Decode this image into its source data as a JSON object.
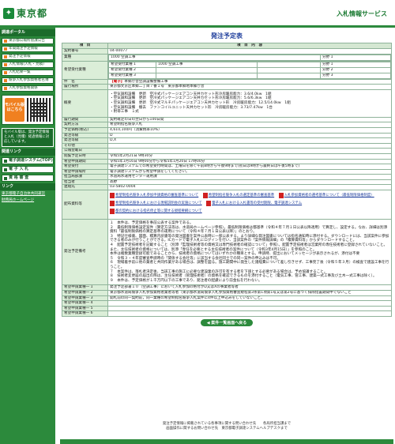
{
  "header": {
    "logo_text": "東京都",
    "service_title": "入札情報サービス"
  },
  "sidebar": {
    "menu_head": "調達ポータル",
    "items": [
      "東京都公報所管課公告",
      "年間発注予定情報",
      "発注予定情報",
      "入札情報(入札・見積)",
      "入札結果一覧",
      "競争入札参加資格者名簿",
      "入札参加資格関係"
    ],
    "mobile_button": "モバイル版はこちら",
    "mobile_note": "モバイル版は、発注予定情報と入札（見積）経過情報に対応しています。",
    "links_head": "関連リンク",
    "big_items": [
      "電子調達システム(TOP)",
      "電 子 入 札",
      "資 格 審 査"
    ],
    "links_head2": "リンク",
    "links": [
      "東京都電子自治体共同運営",
      "財務局ホームページ"
    ]
  },
  "main": {
    "page_title": "発注予定表",
    "col_item": "項　目",
    "col_content": "項　目　内　容",
    "rows": {
      "contract_no_label": "契約番号",
      "contract_no": "04-00077",
      "category_label": "業種",
      "category": "1000 空調工事",
      "category_rank": "分野 1",
      "desired_label": "希望受付業種",
      "desired": [
        {
          "name": "希望受付業種 1",
          "value": "1000 空調工事",
          "rank": "分野 1"
        },
        {
          "name": "希望受付業種 2",
          "value": "",
          "rank": "分野 2"
        },
        {
          "name": "希望受付業種 3",
          "value": "",
          "rank": "分野 3"
        }
      ],
      "subject_label": "件　名",
      "subject_tag": "【電子】",
      "subject": "本郷庁舎空調設備整備工事",
      "location_label": "履行場所",
      "location": "東京都文京区本郷二丁目７番１号　東京都本郷地本郷庁舎",
      "summary_label": "概要",
      "summary": [
        "・空気調和設備　更新　空冷式パッケージエアコン天井カセット形冷房暖房能力：3.6/4.0kw　1組",
        "・空気調和設備　更新　空冷式パッケージエアコン天井カセット形冷房暖房能力：5.6/6.3kw　1組",
        "・空気調和設備　更新　空冷式マルチパッケージエアコン天井カセット形　冷房暖房能力：12.5/14.0kw　1組",
        "・空気調和設備　撤去　ファンコイルユニット天井カセット形　冷房暖房能力：3.73/7.47kw　1台",
        "・附帯工事　１式"
      ],
      "period_label": "履行期間",
      "period": "契約確定の日の翌日から100日間",
      "method_label": "契約方法",
      "method": "希望制指名競争入札",
      "price_label": "予定価格(税込)",
      "price": "4,610,100円（消費税率10%）",
      "rank_label": "発注等級",
      "rank": "D",
      "rank2_label": "発注等級",
      "rank2": "D,X",
      "other_label": "その他",
      "other": "",
      "pub_date_label": "公報登載日",
      "pub_date": "",
      "release_label": "閲覧予定日時",
      "release": "令和5年2月21日 9時30分",
      "apply_label": "希望申請期間",
      "apply": "令和5年1月16日 9時00分から令和5年1月20日 17時00分",
      "apply_method_label": "希望受付",
      "apply_method": "電子調達システムでの希望受付時間は、土曜日を除く午前8時から午後9時まで(初日は9時から最終日は午後5時まで)",
      "app_site_label": "希望申請場所",
      "app_site": "電子調達システムから希望申請をしてください。",
      "dept_label": "担当局部課",
      "dept": "水道局水運用センター運用課",
      "person_label": "担当者",
      "person": "髙野",
      "contact_label": "連絡先",
      "contact": "03-5802-0004",
      "docs_label": "配布資料等",
      "docs": [
        "希望制指名競争入札参加申請資格の審査基準について",
        "希望制指名競争入札の選定基準の審査基準",
        "入札参加資格者の選考基準について（最低制限価格制度）",
        "希望制指名競争入札における現場説明会の実施について",
        "電子入札における入札書等の受付期限、電子調達システム",
        "都の契約における指名停止等に関する規程要綱について"
      ],
      "notice_label": "発注予定備考",
      "notice": [
        "１　本件は、予定価格を事前公表する案件である。",
        "２　最低制限価格設定案件（算定方法等は、水道局ホームページ参照）。最低制限価格は都基準（令和４年７月１日公表以降適用）で算定し、設定する。なお、詳細は別添資料「最低制限価格の算定基準の運用について（令和４年７月１日公表以降）」のとおり。",
        "３　特記仕様書、図面、積算内訳書等の発注図書を案件公表時に一部公表する。より詳細な発注図書については指名通知時に添付する。ダウンロードには、当該案件に参加できる者のみが行うことができる。ICカードで電子入札にログインを行い、当該案件の「案件情報詳細」の「積算資料等」からダウンロードすること。",
        "４　配置予定技術者を記載すること（別添「監理技術者等の資格又は専門技術者の確認について」参照）。配置予定技術者は営業所の専任技術者に登録されていないこと。また、主任技術者の資格については、別添「専任を必要とする主任技術者の案件について（令和3年4月15日）」を参照のこと。",
        "本件は複数業種登録可能であることから、技術者の資格についてはいずれかの種目とする。申請時、提出においてメッセージが表示されるが、添付は不要",
        "５　令和３・４年度審査申請時の「関係する会社等」に該当する会社同士での同一案件の申込みは不可。",
        "６　現場着手前に他の業者と共同作業がある場合は、調整を図る。施工期間中に発生した諸経費について差し引きせず、工事完了後（令和５年３月）の検査で建設工事を行うこと。",
        "７　本案件は、落札者決定後、当該工事の施工に必要な建設業の許可を有する者を下請とする必要がある場合は、予め協議すること。",
        "８　技術者変更届の届出の際は、主任技術者（管理技術者）の資格を確認できるものを添付すること（電気工事、管工事、建築一式工事及び土木一式工事は除く）。",
        "９　本件は、予定価格が１千万円以下の工事であり、発注者の配慮により前金払を行わない。"
      ],
      "extra_label": "発注予定備考2",
      "extra": [
        {
          "label": "希望申請業種一 1",
          "value": "発注予定部署１０（空調工事）において入札参加の格付がD又はXの事業者等者"
        },
        {
          "label": "希望申請業種一 2",
          "value": "東京都水道局競争入札参加資格者業者等者（東京都水道局競争入札参加資格審査規程第3条第1項第1号又は第2号に基づく排除措置期間中でないこと"
        },
        {
          "label": "希望申請業種一 3",
          "value": "開札前の同一契約前，同一業種の希望制指名競争入札案件に4件以上申込みをしていないこと。"
        },
        {
          "label": "希望申請業種一 4",
          "value": ""
        },
        {
          "label": "希望申請業種一 5",
          "value": ""
        },
        {
          "label": "希望申請業種一 6",
          "value": ""
        }
      ]
    },
    "back_button": "◀ 案件一覧画面へ戻る"
  },
  "footer": {
    "line1": "発注予定情報に掲載されている各事項に関する問い合わせ先　　各局所担当課まで",
    "line2": "画面操作に関するお問い合わせ先　東京都電子調達システムヘルプデスクまで"
  },
  "colors": {
    "brand_green": "#2c8a3c",
    "label_bg": "#dbeed8",
    "title_blue": "#1a3a9a",
    "accent_red": "#d01010"
  }
}
